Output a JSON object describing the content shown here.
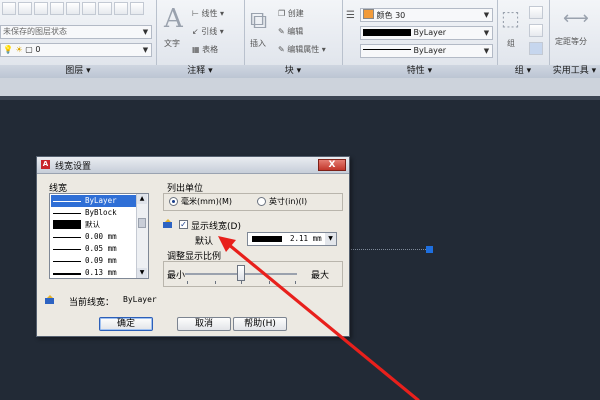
{
  "ribbon": {
    "layers": {
      "title": "图层",
      "state_combo": "未保存的图层状态",
      "layer_combo": "0"
    },
    "annotation": {
      "title": "注释",
      "text_label": "文字",
      "linear_label": "线性",
      "leader_label": "引线",
      "table_label": "表格"
    },
    "block": {
      "title": "块",
      "insert_label": "插入",
      "create_label": "创建",
      "edit_label": "编辑",
      "edit_attr_label": "编辑属性"
    },
    "properties": {
      "title": "特性",
      "color_value": "颜色 30",
      "lineweight_value": "ByLayer",
      "linetype_value": "ByLayer"
    },
    "group": {
      "title": "组",
      "group_label": "组"
    },
    "utilities": {
      "title": "实用工具",
      "measure_label": "定距等分"
    }
  },
  "dialog": {
    "title": "线宽设置",
    "close_label": "X",
    "lineweights_label": "线宽",
    "list_items": [
      {
        "label": "ByLayer",
        "selected": true
      },
      {
        "label": "ByBlock",
        "selected": false
      },
      {
        "label": "默认",
        "selected": false
      },
      {
        "label": "0.00 mm",
        "selected": false
      },
      {
        "label": "0.05 mm",
        "selected": false
      },
      {
        "label": "0.09 mm",
        "selected": false
      },
      {
        "label": "0.13 mm",
        "selected": false
      }
    ],
    "units_label": "列出单位",
    "unit_mm": "毫米(mm)(M)",
    "unit_in": "英寸(in)(I)",
    "display_lw_label": "显示线宽(D)",
    "default_label": "默认",
    "default_value": "2.11 mm",
    "scale_label": "调整显示比例",
    "scale_min": "最小",
    "scale_max": "最大",
    "scale_position": 0.5,
    "current_label": "当前线宽：",
    "current_value": "ByLayer",
    "ok_label": "确定",
    "cancel_label": "取消",
    "help_label": "帮助(H)"
  },
  "colors": {
    "canvas": "#222a36",
    "selection": "#2f6fd6",
    "grip": "#1e6fe0",
    "annotation_arrow": "#e8201c"
  }
}
